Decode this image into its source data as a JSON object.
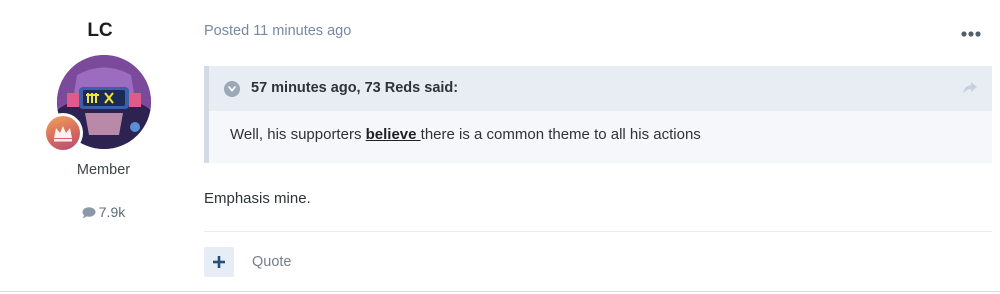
{
  "author": {
    "username": "LC",
    "member_title": "Member",
    "post_count": "7.9k",
    "avatar_icon": "cyberpunk-avatar-image",
    "rank_icon": "crown-icon",
    "count_icon": "comment-bubble-icon"
  },
  "post": {
    "posted_prefix": "Posted",
    "posted_time": "11 minutes ago",
    "quote": {
      "citation": "57 minutes ago, 73 Reds said:",
      "text_before": "Well, his supporters ",
      "text_emphasis": "believe ",
      "text_after": "there is a common theme to all his actions"
    },
    "body": "Emphasis mine."
  },
  "actions": {
    "quote_label": "Quote",
    "react_icon": "plus-icon",
    "more_icon": "ellipsis-icon",
    "share_icon": "share-arrow-icon"
  },
  "colors": {
    "accent": "#214f7e",
    "meta_text": "#7689a1",
    "quote_bg": "#f5f7fa",
    "quote_header_bg": "#e8edf3"
  }
}
